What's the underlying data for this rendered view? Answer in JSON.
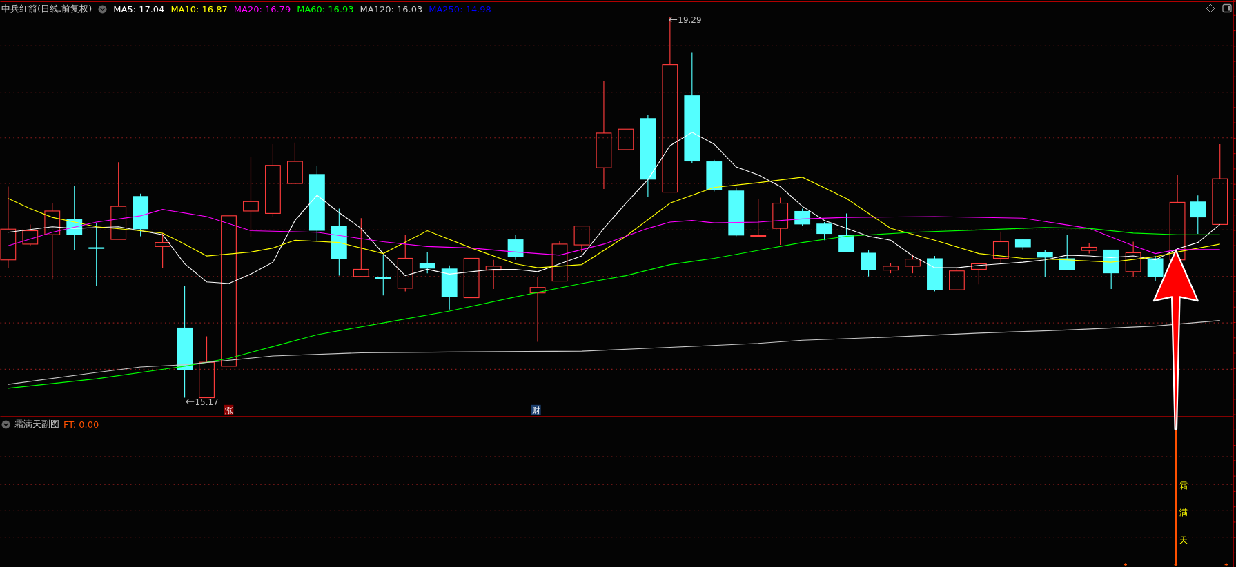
{
  "title": "中兵红箭(日线.前复权)",
  "moving_averages": [
    {
      "label": "MA5:",
      "value": "17.04",
      "color": "#ffffff"
    },
    {
      "label": "MA10:",
      "value": "16.87",
      "color": "#ffff00"
    },
    {
      "label": "MA20:",
      "value": "16.79",
      "color": "#ff00ff"
    },
    {
      "label": "MA60:",
      "value": "16.93",
      "color": "#00ff00"
    },
    {
      "label": "MA120:",
      "value": "16.03",
      "color": "#c8c8c8"
    },
    {
      "label": "MA250:",
      "value": "14.98",
      "color": "#0000ff"
    }
  ],
  "price_labels": [
    {
      "text": "19.29",
      "kind": "high"
    },
    {
      "text": "15.17",
      "kind": "low"
    }
  ],
  "tags": [
    {
      "text": "涨",
      "color": "#8b0000"
    },
    {
      "text": "财",
      "color": "#1c3f6e"
    }
  ],
  "sub_panel": {
    "title": "霜满天副图",
    "indicator": "FT: 0.00",
    "signal_text": "霜满天"
  }
}
